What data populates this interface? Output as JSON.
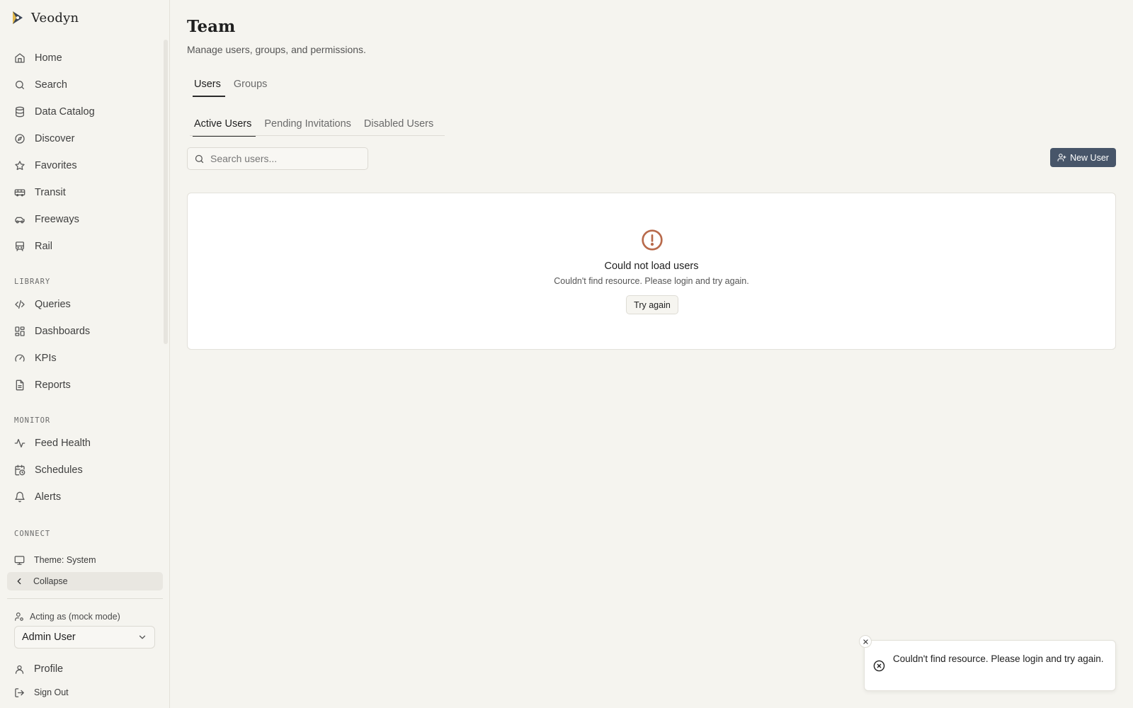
{
  "brand": {
    "name": "Veodyn"
  },
  "sidebar": {
    "main_items": [
      {
        "label": "Home",
        "icon": "home-icon"
      },
      {
        "label": "Search",
        "icon": "search-icon"
      },
      {
        "label": "Data Catalog",
        "icon": "database-icon"
      },
      {
        "label": "Discover",
        "icon": "compass-icon"
      },
      {
        "label": "Favorites",
        "icon": "star-icon"
      },
      {
        "label": "Transit",
        "icon": "bus-icon"
      },
      {
        "label": "Freeways",
        "icon": "car-icon"
      },
      {
        "label": "Rail",
        "icon": "train-icon"
      }
    ],
    "library_title": "LIBRARY",
    "library_items": [
      {
        "label": "Queries",
        "icon": "code-icon"
      },
      {
        "label": "Dashboards",
        "icon": "dashboard-icon"
      },
      {
        "label": "KPIs",
        "icon": "gauge-icon"
      },
      {
        "label": "Reports",
        "icon": "report-icon"
      }
    ],
    "monitor_title": "MONITOR",
    "monitor_items": [
      {
        "label": "Feed Health",
        "icon": "activity-icon"
      },
      {
        "label": "Schedules",
        "icon": "calendar-clock-icon"
      },
      {
        "label": "Alerts",
        "icon": "bell-icon"
      }
    ],
    "connect_title": "CONNECT",
    "theme_label": "Theme: System",
    "collapse_label": "Collapse",
    "acting_as_label": "Acting as (mock mode)",
    "acting_user": "Admin User",
    "profile_label": "Profile",
    "signout_label": "Sign Out"
  },
  "page": {
    "title": "Team",
    "subtitle": "Manage users, groups, and permissions."
  },
  "top_tabs": [
    "Users",
    "Groups"
  ],
  "sub_tabs": [
    "Active Users",
    "Pending Invitations",
    "Disabled Users"
  ],
  "search": {
    "placeholder": "Search users..."
  },
  "new_user_label": "New User",
  "error": {
    "title": "Could not load users",
    "message": "Couldn't find resource. Please login and try again.",
    "retry_label": "Try again"
  },
  "toast": {
    "message": "Couldn't find resource. Please login and try again."
  },
  "colors": {
    "background": "#f5f4ef",
    "primary_button": "#475569",
    "error_accent": "#b86a4b"
  }
}
